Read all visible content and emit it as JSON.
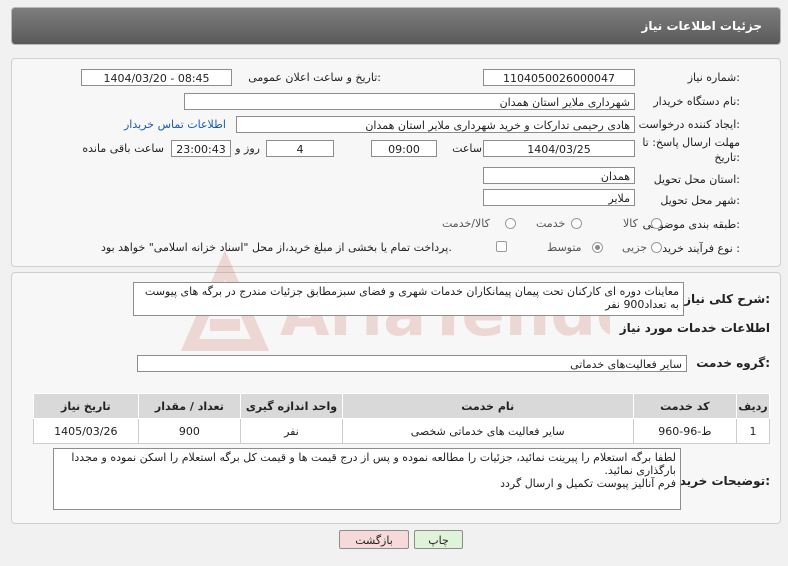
{
  "header": {
    "title": "جزئیات اطلاعات نیاز"
  },
  "form": {
    "need_number_label": "شماره نیاز:",
    "need_number": "1104050026000047",
    "announce_label": "تاریخ و ساعت اعلان عمومی:",
    "announce_value": "1404/03/20 - 08:45",
    "buyer_org_label": "نام دستگاه خریدار:",
    "buyer_org": "شهرداری ملایر استان همدان",
    "creator_label": "ایجاد کننده درخواست:",
    "creator": "هادی رحیمی تدارکات و خرید شهرداری ملایر استان همدان",
    "contact_link": "اطلاعات تماس خریدار",
    "deadline_label_1": "مهلت ارسال پاسخ: تا",
    "deadline_label_2": "تاریخ:",
    "deadline_date": "1404/03/25",
    "hour_label": "ساعت",
    "deadline_time": "09:00",
    "days_value": "4",
    "days_label": "روز و",
    "remaining_time": "23:00:43",
    "remaining_label": "ساعت باقی مانده",
    "province_label": "استان محل تحویل:",
    "province": "همدان",
    "city_label": "شهر محل تحویل:",
    "city": "ملایر",
    "category_label": "طبقه بندی موضوعی:",
    "category_options": [
      "کالا",
      "خدمت",
      "کالا/خدمت"
    ],
    "process_label": "نوع فرآیند خرید :",
    "process_options": [
      "جزیی",
      "متوسط"
    ],
    "payment_note": "پرداخت تمام یا بخشی از مبلغ خرید،از محل \"اسناد خزانه اسلامی\" خواهد بود."
  },
  "summary": {
    "label": "شرح کلی نیاز:",
    "text": "معاینات دوره ای کارکنان تحت پیمان پیمانکاران خدمات شهری و فضای سبزمطابق جزئیات مندرج در برگه های پیوست به تعداد900 نفر"
  },
  "services": {
    "section_title": "اطلاعات خدمات مورد نیاز",
    "group_label": "گروه خدمت:",
    "group_value": "سایر فعالیت‌های خدماتی",
    "columns": [
      "ردیف",
      "کد خدمت",
      "نام خدمت",
      "واحد اندازه گیری",
      "تعداد / مقدار",
      "تاریخ نیاز"
    ],
    "rows": [
      [
        "1",
        "ط-96-960",
        "سایر فعالیت های خدماتی شخصی",
        "نفر",
        "900",
        "1405/03/26"
      ]
    ]
  },
  "buyer_notes": {
    "label": "توضیحات خریدار:",
    "lines": [
      "لطفا برگه استعلام را پیرینت نمائید، جزئیات را مطالعه نموده و پس از درج قیمت ها و قیمت کل برگه استعلام را اسکن نموده و مجددا بارگذاری نمائید.",
      "فرم آنالیز پیوست تکمیل و ارسال گردد"
    ]
  },
  "buttons": {
    "print": "چاپ",
    "back": "بازگشت"
  },
  "watermark": {
    "text": "AriaTender.net"
  },
  "colors": {
    "link": "#1a5bb0",
    "title_bg": "#6b6b6b",
    "print_bg": "#dff3d9",
    "back_bg": "#f6d9d9",
    "watermark": "#c0392b"
  }
}
